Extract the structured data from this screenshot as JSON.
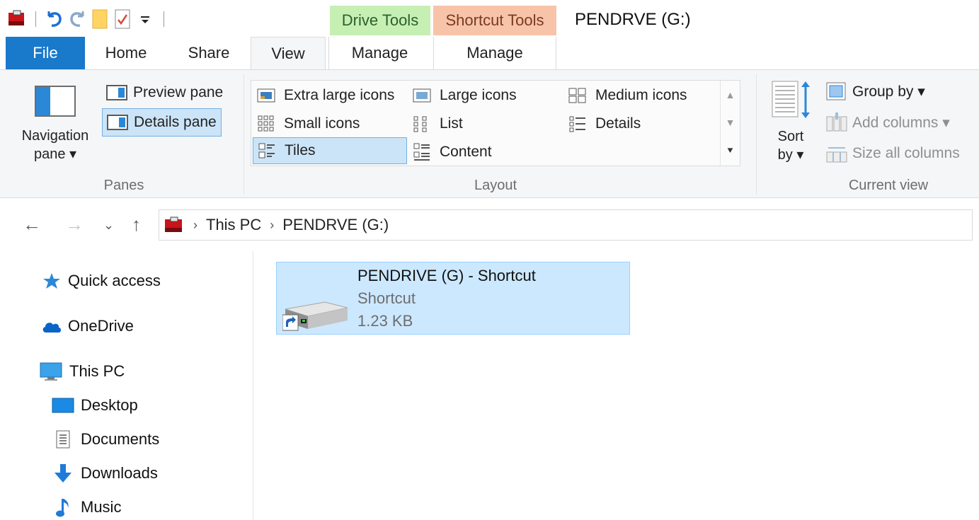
{
  "window": {
    "title": "PENDRVE (G:)",
    "context_tabs": {
      "drive_tools": "Drive Tools",
      "shortcut_tools": "Shortcut Tools"
    }
  },
  "ribbon_tabs": {
    "file": "File",
    "home": "Home",
    "share": "Share",
    "view": "View",
    "manage_drive": "Manage",
    "manage_shortcut": "Manage",
    "active": "View"
  },
  "ribbon": {
    "panes": {
      "navigation_pane": "Navigation",
      "navigation_pane_line2": "pane ▾",
      "preview_pane": "Preview pane",
      "details_pane": "Details pane",
      "group_label": "Panes"
    },
    "layout": {
      "group_label": "Layout",
      "items": [
        {
          "label": "Extra large icons",
          "icon": "extra-large-icons-icon"
        },
        {
          "label": "Large icons",
          "icon": "large-icons-icon"
        },
        {
          "label": "Medium icons",
          "icon": "medium-icons-icon"
        },
        {
          "label": "Small icons",
          "icon": "small-icons-icon"
        },
        {
          "label": "List",
          "icon": "list-icon"
        },
        {
          "label": "Details",
          "icon": "details-icon"
        },
        {
          "label": "Tiles",
          "icon": "tiles-icon",
          "selected": true
        },
        {
          "label": "Content",
          "icon": "content-icon"
        }
      ]
    },
    "current_view": {
      "group_label": "Current view",
      "sort_by": "Sort",
      "sort_by_line2": "by ▾",
      "group_by": "Group by ▾",
      "add_columns": "Add columns ▾",
      "size_all_columns": "Size all columns"
    }
  },
  "address_bar": {
    "crumbs": [
      "This PC",
      "PENDRVE (G:)"
    ]
  },
  "sidebar": {
    "items": [
      {
        "label": "Quick access",
        "icon": "star-icon"
      },
      {
        "label": "OneDrive",
        "icon": "cloud-icon"
      },
      {
        "label": "This PC",
        "icon": "computer-icon"
      },
      {
        "label": "Desktop",
        "icon": "desktop-icon"
      },
      {
        "label": "Documents",
        "icon": "document-icon"
      },
      {
        "label": "Downloads",
        "icon": "download-arrow-icon"
      },
      {
        "label": "Music",
        "icon": "music-note-icon"
      }
    ]
  },
  "files": [
    {
      "name": "PENDRIVE (G) - Shortcut",
      "type": "Shortcut",
      "size": "1.23 KB",
      "icon": "drive-shortcut-icon"
    }
  ],
  "colors": {
    "file_tab": "#1979ca",
    "selection": "#cce8ff",
    "drive_tools": "#c6efb4",
    "shortcut_tools": "#f7c4aa"
  }
}
